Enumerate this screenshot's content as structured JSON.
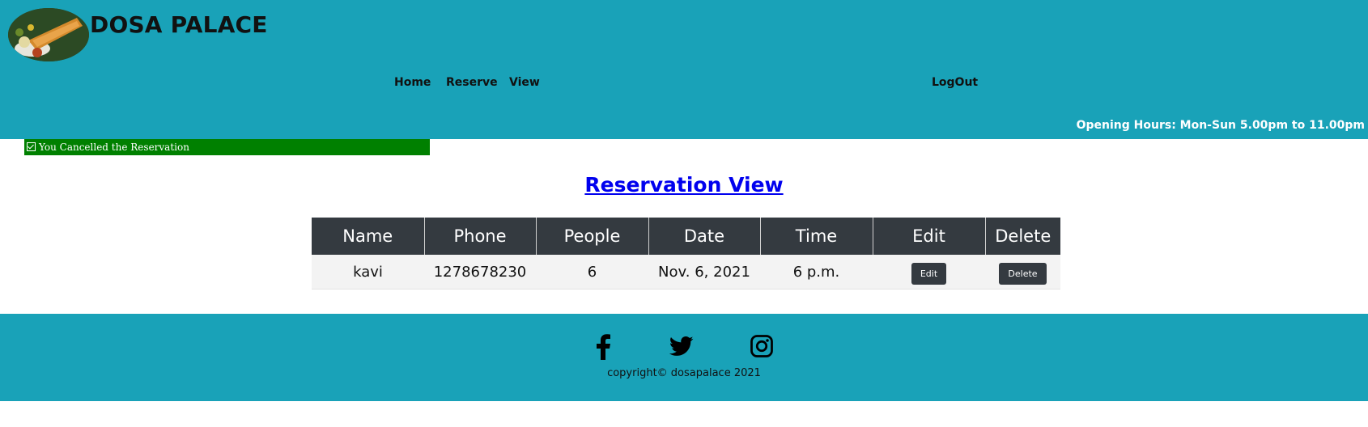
{
  "header": {
    "brand": "DOSA PALACE",
    "logo_icon": "dosa-plate-logo",
    "nav": {
      "home": "Home",
      "reserve": "Reserve",
      "view": "View",
      "logout": "LogOut"
    },
    "opening_hours": "Opening Hours: Mon-Sun 5.00pm to 11.00pm"
  },
  "alert": {
    "message": "You Cancelled the Reservation",
    "icon": "check-square-icon",
    "color": "#008000"
  },
  "main": {
    "title": "Reservation View",
    "table": {
      "columns": [
        "Name",
        "Phone",
        "People",
        "Date",
        "Time",
        "Edit",
        "Delete"
      ],
      "rows": [
        {
          "name": "kavi",
          "phone": "1278678230",
          "people": "6",
          "date": "Nov. 6, 2021",
          "time": "6 p.m.",
          "edit_label": "Edit",
          "delete_label": "Delete"
        }
      ]
    }
  },
  "footer": {
    "social_icons": [
      "facebook-icon",
      "twitter-icon",
      "instagram-icon"
    ],
    "copyright": "copyright© dosapalace 2021"
  },
  "colors": {
    "header_bg": "#19a2b8",
    "table_header_bg": "#343a40",
    "button_bg": "#343a40"
  }
}
